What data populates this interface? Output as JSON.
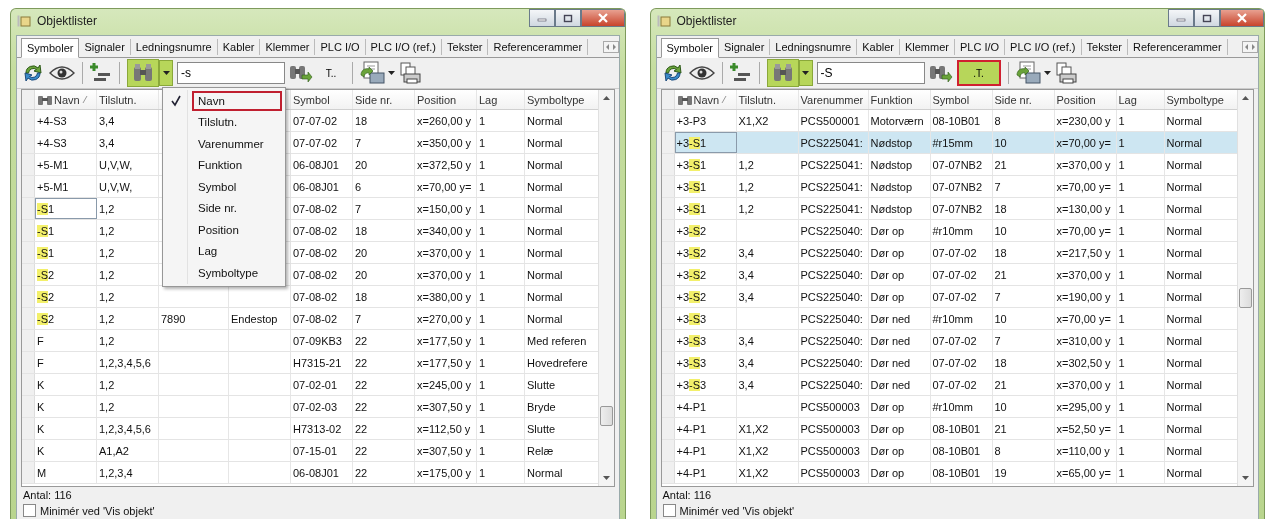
{
  "windows": [
    {
      "title": "Objektlister",
      "tabs": [
        {
          "label": "Symboler",
          "selected": true
        },
        {
          "label": "Signaler",
          "selected": false
        },
        {
          "label": "Ledningsnumre",
          "selected": false
        },
        {
          "label": "Kabler",
          "selected": false
        },
        {
          "label": "Klemmer",
          "selected": false
        },
        {
          "label": "PLC I/O",
          "selected": false
        },
        {
          "label": "PLC I/O (ref.)",
          "selected": false
        },
        {
          "label": "Tekster",
          "selected": false
        },
        {
          "label": "Referencerammer",
          "selected": false
        }
      ],
      "toolbar": {
        "find_on": true,
        "search": {
          "value": "-s"
        },
        "text_filter": {
          "label": "T..",
          "on": false,
          "highlighted": false
        }
      },
      "columns": [
        {
          "label": "Navn",
          "sorted": true
        },
        {
          "label": "Tilslutn."
        },
        {},
        {},
        {
          "label": "Symbol"
        },
        {
          "label": "Side nr."
        },
        {
          "label": "Position"
        },
        {
          "label": "Lag"
        },
        {
          "label": "Symboltype"
        }
      ],
      "rows": [
        {
          "name": [
            {
              "text": "+4-S3",
              "highlighted": false
            }
          ],
          "tilslutn": "3,4",
          "symbol": "07-07-02",
          "side": "18",
          "position": "x=260,00 y",
          "lag": "1",
          "symboltype": "Normal",
          "selected": false,
          "focused": false
        },
        {
          "name": [
            {
              "text": "+4-S3",
              "highlighted": false
            }
          ],
          "tilslutn": "3,4",
          "symbol": "07-07-02",
          "side": "7",
          "position": "x=350,00 y",
          "lag": "1",
          "symboltype": "Normal",
          "selected": false,
          "focused": false
        },
        {
          "name": [
            {
              "text": "+5-M1",
              "highlighted": false
            }
          ],
          "tilslutn": "U,V,W,",
          "symbol": "06-08J01",
          "side": "20",
          "position": "x=372,50 y",
          "lag": "1",
          "symboltype": "Normal",
          "selected": false,
          "focused": false
        },
        {
          "name": [
            {
              "text": "+5-M1",
              "highlighted": false
            }
          ],
          "tilslutn": "U,V,W,",
          "symbol": "06-08J01",
          "side": "6",
          "position": "x=70,00 y=",
          "lag": "1",
          "symboltype": "Normal",
          "selected": false,
          "focused": false
        },
        {
          "name": [
            {
              "text": "-S",
              "highlighted": true
            },
            {
              "text": "1",
              "highlighted": false
            }
          ],
          "tilslutn": "1,2",
          "symbol": "07-08-02",
          "side": "7",
          "position": "x=150,00 y",
          "lag": "1",
          "symboltype": "Normal",
          "selected": false,
          "focused": true
        },
        {
          "name": [
            {
              "text": "-S",
              "highlighted": true
            },
            {
              "text": "1",
              "highlighted": false
            }
          ],
          "tilslutn": "1,2",
          "symbol": "07-08-02",
          "side": "18",
          "position": "x=340,00 y",
          "lag": "1",
          "symboltype": "Normal",
          "selected": false,
          "focused": false
        },
        {
          "name": [
            {
              "text": "-S",
              "highlighted": true
            },
            {
              "text": "1",
              "highlighted": false
            }
          ],
          "tilslutn": "1,2",
          "symbol": "07-08-02",
          "side": "20",
          "position": "x=370,00 y",
          "lag": "1",
          "symboltype": "Normal",
          "selected": false,
          "focused": false
        },
        {
          "name": [
            {
              "text": "-S",
              "highlighted": true
            },
            {
              "text": "2",
              "highlighted": false
            }
          ],
          "tilslutn": "1,2",
          "symbol": "07-08-02",
          "side": "20",
          "position": "x=370,00 y",
          "lag": "1",
          "symboltype": "Normal",
          "selected": false,
          "focused": false
        },
        {
          "name": [
            {
              "text": "-S",
              "highlighted": true
            },
            {
              "text": "2",
              "highlighted": false
            }
          ],
          "tilslutn": "1,2",
          "symbol": "07-08-02",
          "side": "18",
          "position": "x=380,00 y",
          "lag": "1",
          "symboltype": "Normal",
          "selected": false,
          "focused": false
        },
        {
          "name": [
            {
              "text": "-S",
              "highlighted": true
            },
            {
              "text": "2",
              "highlighted": false
            }
          ],
          "tilslutn": "1,2",
          "varenummer": "7890",
          "funktion": "Endestop",
          "symbol": "07-08-02",
          "side": "7",
          "position": "x=270,00 y",
          "lag": "1",
          "symboltype": "Normal",
          "selected": false,
          "focused": false
        },
        {
          "name": [
            {
              "text": "F",
              "highlighted": false
            }
          ],
          "tilslutn": "1,2",
          "symbol": "07-09KB3",
          "side": "22",
          "position": "x=177,50 y",
          "lag": "1",
          "symboltype": "Med referen",
          "selected": false,
          "focused": false
        },
        {
          "name": [
            {
              "text": "F",
              "highlighted": false
            }
          ],
          "tilslutn": "1,2,3,4,5,6",
          "symbol": "H7315-21",
          "side": "22",
          "position": "x=177,50 y",
          "lag": "1",
          "symboltype": "Hovedrefere",
          "selected": false,
          "focused": false
        },
        {
          "name": [
            {
              "text": "K",
              "highlighted": false
            }
          ],
          "tilslutn": "1,2",
          "symbol": "07-02-01",
          "side": "22",
          "position": "x=245,00 y",
          "lag": "1",
          "symboltype": "Slutte",
          "selected": false,
          "focused": false
        },
        {
          "name": [
            {
              "text": "K",
              "highlighted": false
            }
          ],
          "tilslutn": "1,2",
          "symbol": "07-02-03",
          "side": "22",
          "position": "x=307,50 y",
          "lag": "1",
          "symboltype": "Bryde",
          "selected": false,
          "focused": false
        },
        {
          "name": [
            {
              "text": "K",
              "highlighted": false
            }
          ],
          "tilslutn": "1,2,3,4,5,6",
          "symbol": "H7313-02",
          "side": "22",
          "position": "x=112,50 y",
          "lag": "1",
          "symboltype": "Slutte",
          "selected": false,
          "focused": false
        },
        {
          "name": [
            {
              "text": "K",
              "highlighted": false
            }
          ],
          "tilslutn": "A1,A2",
          "symbol": "07-15-01",
          "side": "22",
          "position": "x=307,50 y",
          "lag": "1",
          "symboltype": "Relæ",
          "selected": false,
          "focused": false
        },
        {
          "name": [
            {
              "text": "M",
              "highlighted": false
            }
          ],
          "tilslutn": "1,2,3,4",
          "symbol": "06-08J01",
          "side": "22",
          "position": "x=175,00 y",
          "lag": "1",
          "symboltype": "Normal",
          "selected": false,
          "focused": false
        }
      ],
      "menu": {
        "items": [
          {
            "label": "Navn",
            "checked": true,
            "highlighted": true
          },
          {
            "label": "Tilslutn.",
            "checked": false,
            "highlighted": false
          },
          {
            "label": "Varenummer",
            "checked": false,
            "highlighted": false
          },
          {
            "label": "Funktion",
            "checked": false,
            "highlighted": false
          },
          {
            "label": "Symbol",
            "checked": false,
            "highlighted": false
          },
          {
            "label": "Side nr.",
            "checked": false,
            "highlighted": false
          },
          {
            "label": "Position",
            "checked": false,
            "highlighted": false
          },
          {
            "label": "Lag",
            "checked": false,
            "highlighted": false
          },
          {
            "label": "Symboltype",
            "checked": false,
            "highlighted": false
          }
        ]
      },
      "count": "Antal: 116",
      "option": {
        "label": "Minimér ved 'Vis objekt'",
        "checked": false
      }
    },
    {
      "title": "Objektlister",
      "tabs": [
        {
          "label": "Symboler",
          "selected": true
        },
        {
          "label": "Signaler",
          "selected": false
        },
        {
          "label": "Ledningsnumre",
          "selected": false
        },
        {
          "label": "Kabler",
          "selected": false
        },
        {
          "label": "Klemmer",
          "selected": false
        },
        {
          "label": "PLC I/O",
          "selected": false
        },
        {
          "label": "PLC I/O (ref.)",
          "selected": false
        },
        {
          "label": "Tekster",
          "selected": false
        },
        {
          "label": "Referencerammer",
          "selected": false
        }
      ],
      "toolbar": {
        "find_on": true,
        "search": {
          "value": "-S"
        },
        "text_filter": {
          "label": ".T.",
          "on": true,
          "highlighted": true
        }
      },
      "columns": [
        {
          "label": "Navn",
          "sorted": true
        },
        {
          "label": "Tilslutn."
        },
        {
          "label": "Varenummer"
        },
        {
          "label": "Funktion"
        },
        {
          "label": "Symbol"
        },
        {
          "label": "Side nr."
        },
        {
          "label": "Position"
        },
        {
          "label": "Lag"
        },
        {
          "label": "Symboltype"
        }
      ],
      "rows": [
        {
          "name": [
            {
              "text": "+3-P3",
              "highlighted": false
            }
          ],
          "tilslutn": "X1,X2",
          "varenummer": "PCS500001",
          "funktion": "Motorværn",
          "symbol": "08-10B01",
          "side": "8",
          "position": "x=230,00 y",
          "lag": "1",
          "symboltype": "Normal",
          "selected": false,
          "focused": false
        },
        {
          "name": [
            {
              "text": "+3",
              "highlighted": false
            },
            {
              "text": "-S",
              "highlighted": true
            },
            {
              "text": "1",
              "highlighted": false
            }
          ],
          "varenummer": "PCS225041:",
          "funktion": "Nødstop",
          "symbol": "#r15mm",
          "side": "10",
          "position": "x=70,00 y=",
          "lag": "1",
          "symboltype": "Normal",
          "selected": true,
          "focused": true
        },
        {
          "name": [
            {
              "text": "+3",
              "highlighted": false
            },
            {
              "text": "-S",
              "highlighted": true
            },
            {
              "text": "1",
              "highlighted": false
            }
          ],
          "tilslutn": "1,2",
          "varenummer": "PCS225041:",
          "funktion": "Nødstop",
          "symbol": "07-07NB2",
          "side": "21",
          "position": "x=370,00 y",
          "lag": "1",
          "symboltype": "Normal",
          "selected": false,
          "focused": false
        },
        {
          "name": [
            {
              "text": "+3",
              "highlighted": false
            },
            {
              "text": "-S",
              "highlighted": true
            },
            {
              "text": "1",
              "highlighted": false
            }
          ],
          "tilslutn": "1,2",
          "varenummer": "PCS225041:",
          "funktion": "Nødstop",
          "symbol": "07-07NB2",
          "side": "7",
          "position": "x=70,00 y=",
          "lag": "1",
          "symboltype": "Normal",
          "selected": false,
          "focused": false
        },
        {
          "name": [
            {
              "text": "+3",
              "highlighted": false
            },
            {
              "text": "-S",
              "highlighted": true
            },
            {
              "text": "1",
              "highlighted": false
            }
          ],
          "tilslutn": "1,2",
          "varenummer": "PCS225041:",
          "funktion": "Nødstop",
          "symbol": "07-07NB2",
          "side": "18",
          "position": "x=130,00 y",
          "lag": "1",
          "symboltype": "Normal",
          "selected": false,
          "focused": false
        },
        {
          "name": [
            {
              "text": "+3",
              "highlighted": false
            },
            {
              "text": "-S",
              "highlighted": true
            },
            {
              "text": "2",
              "highlighted": false
            }
          ],
          "varenummer": "PCS225040:",
          "funktion": "Dør op",
          "symbol": "#r10mm",
          "side": "10",
          "position": "x=70,00 y=",
          "lag": "1",
          "symboltype": "Normal",
          "selected": false,
          "focused": false
        },
        {
          "name": [
            {
              "text": "+3",
              "highlighted": false
            },
            {
              "text": "-S",
              "highlighted": true
            },
            {
              "text": "2",
              "highlighted": false
            }
          ],
          "tilslutn": "3,4",
          "varenummer": "PCS225040:",
          "funktion": "Dør op",
          "symbol": "07-07-02",
          "side": "18",
          "position": "x=217,50 y",
          "lag": "1",
          "symboltype": "Normal",
          "selected": false,
          "focused": false
        },
        {
          "name": [
            {
              "text": "+3",
              "highlighted": false
            },
            {
              "text": "-S",
              "highlighted": true
            },
            {
              "text": "2",
              "highlighted": false
            }
          ],
          "tilslutn": "3,4",
          "varenummer": "PCS225040:",
          "funktion": "Dør op",
          "symbol": "07-07-02",
          "side": "21",
          "position": "x=370,00 y",
          "lag": "1",
          "symboltype": "Normal",
          "selected": false,
          "focused": false
        },
        {
          "name": [
            {
              "text": "+3",
              "highlighted": false
            },
            {
              "text": "-S",
              "highlighted": true
            },
            {
              "text": "2",
              "highlighted": false
            }
          ],
          "tilslutn": "3,4",
          "varenummer": "PCS225040:",
          "funktion": "Dør op",
          "symbol": "07-07-02",
          "side": "7",
          "position": "x=190,00 y",
          "lag": "1",
          "symboltype": "Normal",
          "selected": false,
          "focused": false
        },
        {
          "name": [
            {
              "text": "+3",
              "highlighted": false
            },
            {
              "text": "-S",
              "highlighted": true
            },
            {
              "text": "3",
              "highlighted": false
            }
          ],
          "varenummer": "PCS225040:",
          "funktion": "Dør ned",
          "symbol": "#r10mm",
          "side": "10",
          "position": "x=70,00 y=",
          "lag": "1",
          "symboltype": "Normal",
          "selected": false,
          "focused": false
        },
        {
          "name": [
            {
              "text": "+3",
              "highlighted": false
            },
            {
              "text": "-S",
              "highlighted": true
            },
            {
              "text": "3",
              "highlighted": false
            }
          ],
          "tilslutn": "3,4",
          "varenummer": "PCS225040:",
          "funktion": "Dør ned",
          "symbol": "07-07-02",
          "side": "7",
          "position": "x=310,00 y",
          "lag": "1",
          "symboltype": "Normal",
          "selected": false,
          "focused": false
        },
        {
          "name": [
            {
              "text": "+3",
              "highlighted": false
            },
            {
              "text": "-S",
              "highlighted": true
            },
            {
              "text": "3",
              "highlighted": false
            }
          ],
          "tilslutn": "3,4",
          "varenummer": "PCS225040:",
          "funktion": "Dør ned",
          "symbol": "07-07-02",
          "side": "18",
          "position": "x=302,50 y",
          "lag": "1",
          "symboltype": "Normal",
          "selected": false,
          "focused": false
        },
        {
          "name": [
            {
              "text": "+3",
              "highlighted": false
            },
            {
              "text": "-S",
              "highlighted": true
            },
            {
              "text": "3",
              "highlighted": false
            }
          ],
          "tilslutn": "3,4",
          "varenummer": "PCS225040:",
          "funktion": "Dør ned",
          "symbol": "07-07-02",
          "side": "21",
          "position": "x=370,00 y",
          "lag": "1",
          "symboltype": "Normal",
          "selected": false,
          "focused": false
        },
        {
          "name": [
            {
              "text": "+4-P1",
              "highlighted": false
            }
          ],
          "varenummer": "PCS500003",
          "funktion": "Dør op",
          "symbol": "#r10mm",
          "side": "10",
          "position": "x=295,00 y",
          "lag": "1",
          "symboltype": "Normal",
          "selected": false,
          "focused": false
        },
        {
          "name": [
            {
              "text": "+4-P1",
              "highlighted": false
            }
          ],
          "tilslutn": "X1,X2",
          "varenummer": "PCS500003",
          "funktion": "Dør op",
          "symbol": "08-10B01",
          "side": "21",
          "position": "x=52,50 y=",
          "lag": "1",
          "symboltype": "Normal",
          "selected": false,
          "focused": false
        },
        {
          "name": [
            {
              "text": "+4-P1",
              "highlighted": false
            }
          ],
          "tilslutn": "X1,X2",
          "varenummer": "PCS500003",
          "funktion": "Dør op",
          "symbol": "08-10B01",
          "side": "8",
          "position": "x=110,00 y",
          "lag": "1",
          "symboltype": "Normal",
          "selected": false,
          "focused": false
        },
        {
          "name": [
            {
              "text": "+4-P1",
              "highlighted": false
            }
          ],
          "tilslutn": "X1,X2",
          "varenummer": "PCS500003",
          "funktion": "Dør op",
          "symbol": "08-10B01",
          "side": "19",
          "position": "x=65,00 y=",
          "lag": "1",
          "symboltype": "Normal",
          "selected": false,
          "focused": false
        }
      ],
      "count": "Antal: 116",
      "option": {
        "label": "Minimér ved 'Vis objekt'",
        "checked": false
      }
    }
  ]
}
